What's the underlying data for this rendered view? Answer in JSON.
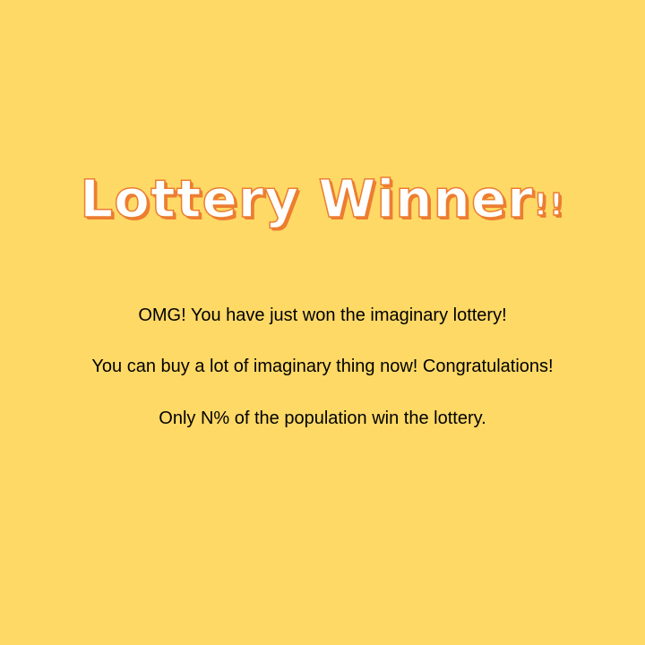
{
  "title": {
    "main": "Lottery Winner",
    "exclaim": "!!"
  },
  "message": {
    "line1": "OMG! You have just won the imaginary lottery!",
    "line2": "You can buy a lot of imaginary thing now! Congratulations!",
    "line3": "Only N% of the population win the lottery."
  },
  "colors": {
    "background": "#FFD966",
    "title_fill": "#FFFFFF",
    "title_outline": "#ED7D31",
    "text": "#000000"
  }
}
